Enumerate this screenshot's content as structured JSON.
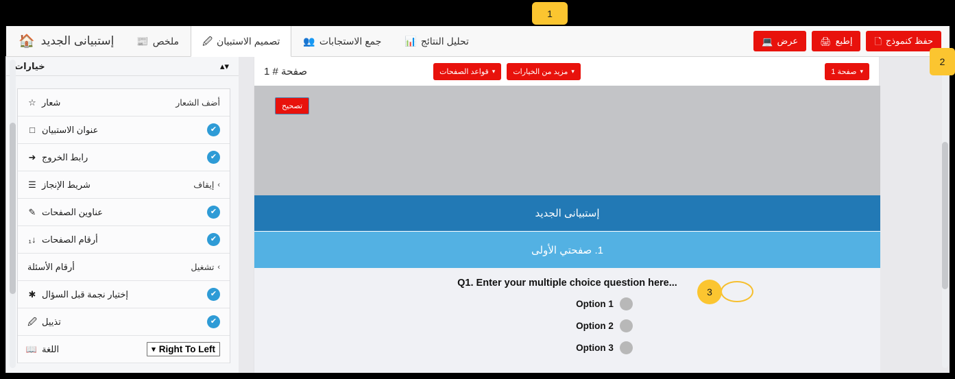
{
  "app": {
    "brand_title": "إستبيانى الجديد",
    "home_icon": "home-icon"
  },
  "navbar": {
    "tabs": [
      {
        "label": "ملخص",
        "icon": "summary-icon",
        "active": false
      },
      {
        "label": "تصميم الاستبيان",
        "icon": "pencil-square-icon",
        "active": true
      },
      {
        "label": "جمع الاستجابات",
        "icon": "people-icon",
        "active": false
      },
      {
        "label": "تحليل النتائج",
        "icon": "bar-chart-icon",
        "active": false
      }
    ],
    "actions": [
      {
        "label": "عرض",
        "icon": "monitor-icon"
      },
      {
        "label": "إطبع",
        "icon": "printer-icon"
      },
      {
        "label": "حفظ كنموذج",
        "icon": "copy-icon"
      }
    ]
  },
  "sidebar": {
    "header_title": "خيارات",
    "header_icon": "chevron-collapse-icon",
    "items": [
      {
        "icon": "star-icon",
        "label": "شعار",
        "control": "text",
        "value": "أضف الشعار"
      },
      {
        "icon": "square-icon",
        "label": "عنوان الاستبيان",
        "control": "toggle",
        "value": "on"
      },
      {
        "icon": "paper-plane-icon",
        "label": "رابط الخروج",
        "control": "toggle",
        "value": "on"
      },
      {
        "icon": "progress-bar-icon",
        "label": "شريط الإنجاز",
        "control": "chevron",
        "value": "إيقاف"
      },
      {
        "icon": "pencil-icon",
        "label": "عناوين الصفحات",
        "control": "toggle",
        "value": "on"
      },
      {
        "icon": "sort-numeric-icon",
        "label": "أرقام الصفحات",
        "control": "toggle",
        "value": "on"
      },
      {
        "icon": "none",
        "label": "أرقام الأسئلة",
        "control": "chevron",
        "value": "تشغيل"
      },
      {
        "icon": "asterisk-icon",
        "label": "إختيار نجمة قبل السؤال",
        "control": "toggle",
        "value": "on"
      },
      {
        "icon": "pencil-square-icon",
        "label": "تذييل",
        "control": "toggle",
        "value": "on"
      },
      {
        "icon": "book-icon",
        "label": "اللغة",
        "control": "select",
        "value": "Right To Left"
      }
    ]
  },
  "designer": {
    "page_title": "صفحة # 1",
    "page_select_label": "صفحة 1",
    "page_rules_label": "قواعد الصفحات",
    "more_options_label": "مزيد من الخيارات",
    "edit_header_label": "تصحيح",
    "survey_title": "إستبيانى الجديد",
    "page_name": "1. صفحتي الأولى",
    "question": {
      "text": "...Q1. Enter your multiple choice question here",
      "options": [
        "Option 1",
        "Option 2",
        "Option 3"
      ]
    }
  },
  "annotations": [
    {
      "id": "1",
      "number": "1"
    },
    {
      "id": "2",
      "number": "2"
    },
    {
      "id": "3",
      "number": "3"
    }
  ],
  "colors": {
    "accent_red": "#e8120c",
    "title_blue": "#2279b5",
    "page_blue": "#53b1e3",
    "toggle_blue": "#2e9bd6",
    "callout_yellow": "#fbc530"
  }
}
